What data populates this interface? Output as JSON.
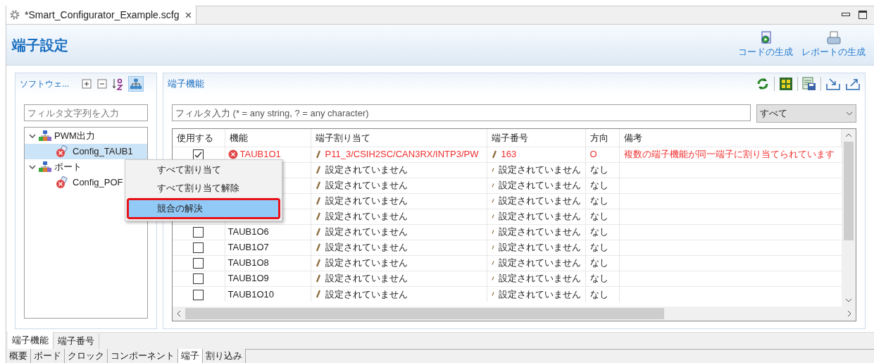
{
  "editor_tab": {
    "title": "*Smart_Configurator_Example.scfg",
    "close": "×"
  },
  "page_title": "端子設定",
  "header_actions": [
    {
      "label": "コードの生成",
      "kind": "code"
    },
    {
      "label": "レポートの生成",
      "kind": "report"
    }
  ],
  "left_panel": {
    "title": "ソフトウェ...",
    "filter_placeholder": "フィルタ文字列を入力",
    "tree": [
      {
        "label": "PWM出力",
        "expanded": true,
        "children": [
          {
            "label": "Config_TAUB1",
            "selected": true,
            "error": true
          }
        ]
      },
      {
        "label": "ポート",
        "expanded": true,
        "children": [
          {
            "label": "Config_POF",
            "selected": false,
            "error": true
          }
        ]
      }
    ]
  },
  "right_panel": {
    "title": "端子機能",
    "filter_placeholder": "フィルタ入力 (* = any string, ? = any character)",
    "filter_scope": "すべて",
    "table": {
      "columns": [
        "使用する",
        "機能",
        "端子割り当て",
        "端子番号",
        "方向",
        "備考"
      ],
      "rows": [
        {
          "used": true,
          "function": "TAUB1O1",
          "assignment": "P11_3/CSIH2SC/CAN3RX/INTP3/PW",
          "pin": "163",
          "direction": "O",
          "note": "複数の端子機能が同一端子に割り当てられています",
          "error": true
        },
        {
          "assignment": "設定されていません",
          "pin": "設定されていません",
          "direction": "なし",
          "error": false
        },
        {
          "assignment": "設定されていません",
          "pin": "設定されていません",
          "direction": "なし",
          "error": false
        },
        {
          "assignment": "設定されていません",
          "pin": "設定されていません",
          "direction": "なし",
          "error": false
        },
        {
          "assignment": "設定されていません",
          "pin": "設定されていません",
          "direction": "なし",
          "error": false
        },
        {
          "used": false,
          "function": "TAUB1O6",
          "assignment": "設定されていません",
          "pin": "設定されていません",
          "direction": "なし",
          "error": false
        },
        {
          "used": false,
          "function": "TAUB1O7",
          "assignment": "設定されていません",
          "pin": "設定されていません",
          "direction": "なし",
          "error": false
        },
        {
          "used": false,
          "function": "TAUB1O8",
          "assignment": "設定されていません",
          "pin": "設定されていません",
          "direction": "なし",
          "error": false
        },
        {
          "used": false,
          "function": "TAUB1O9",
          "assignment": "設定されていません",
          "pin": "設定されていません",
          "direction": "なし",
          "error": false
        },
        {
          "used": false,
          "function": "TAUB1O10",
          "assignment": "設定されていません",
          "pin": "設定されていません",
          "direction": "なし",
          "error": false
        }
      ]
    }
  },
  "context_menu": [
    {
      "label": "すべて割り当て",
      "selected": false,
      "framed": false
    },
    {
      "label": "すべて割り当て解除",
      "selected": false,
      "framed": false
    },
    {
      "label": "競合の解決",
      "selected": true,
      "framed": true
    }
  ],
  "view_tabs": [
    {
      "label": "端子機能",
      "selected": true
    },
    {
      "label": "端子番号",
      "selected": false
    }
  ],
  "page_tabs": [
    {
      "label": "概要",
      "selected": false
    },
    {
      "label": "ボード",
      "selected": false
    },
    {
      "label": "クロック",
      "selected": false
    },
    {
      "label": "コンポーネント",
      "selected": false
    },
    {
      "label": "端子",
      "selected": true
    },
    {
      "label": "割り込み",
      "selected": false
    }
  ]
}
